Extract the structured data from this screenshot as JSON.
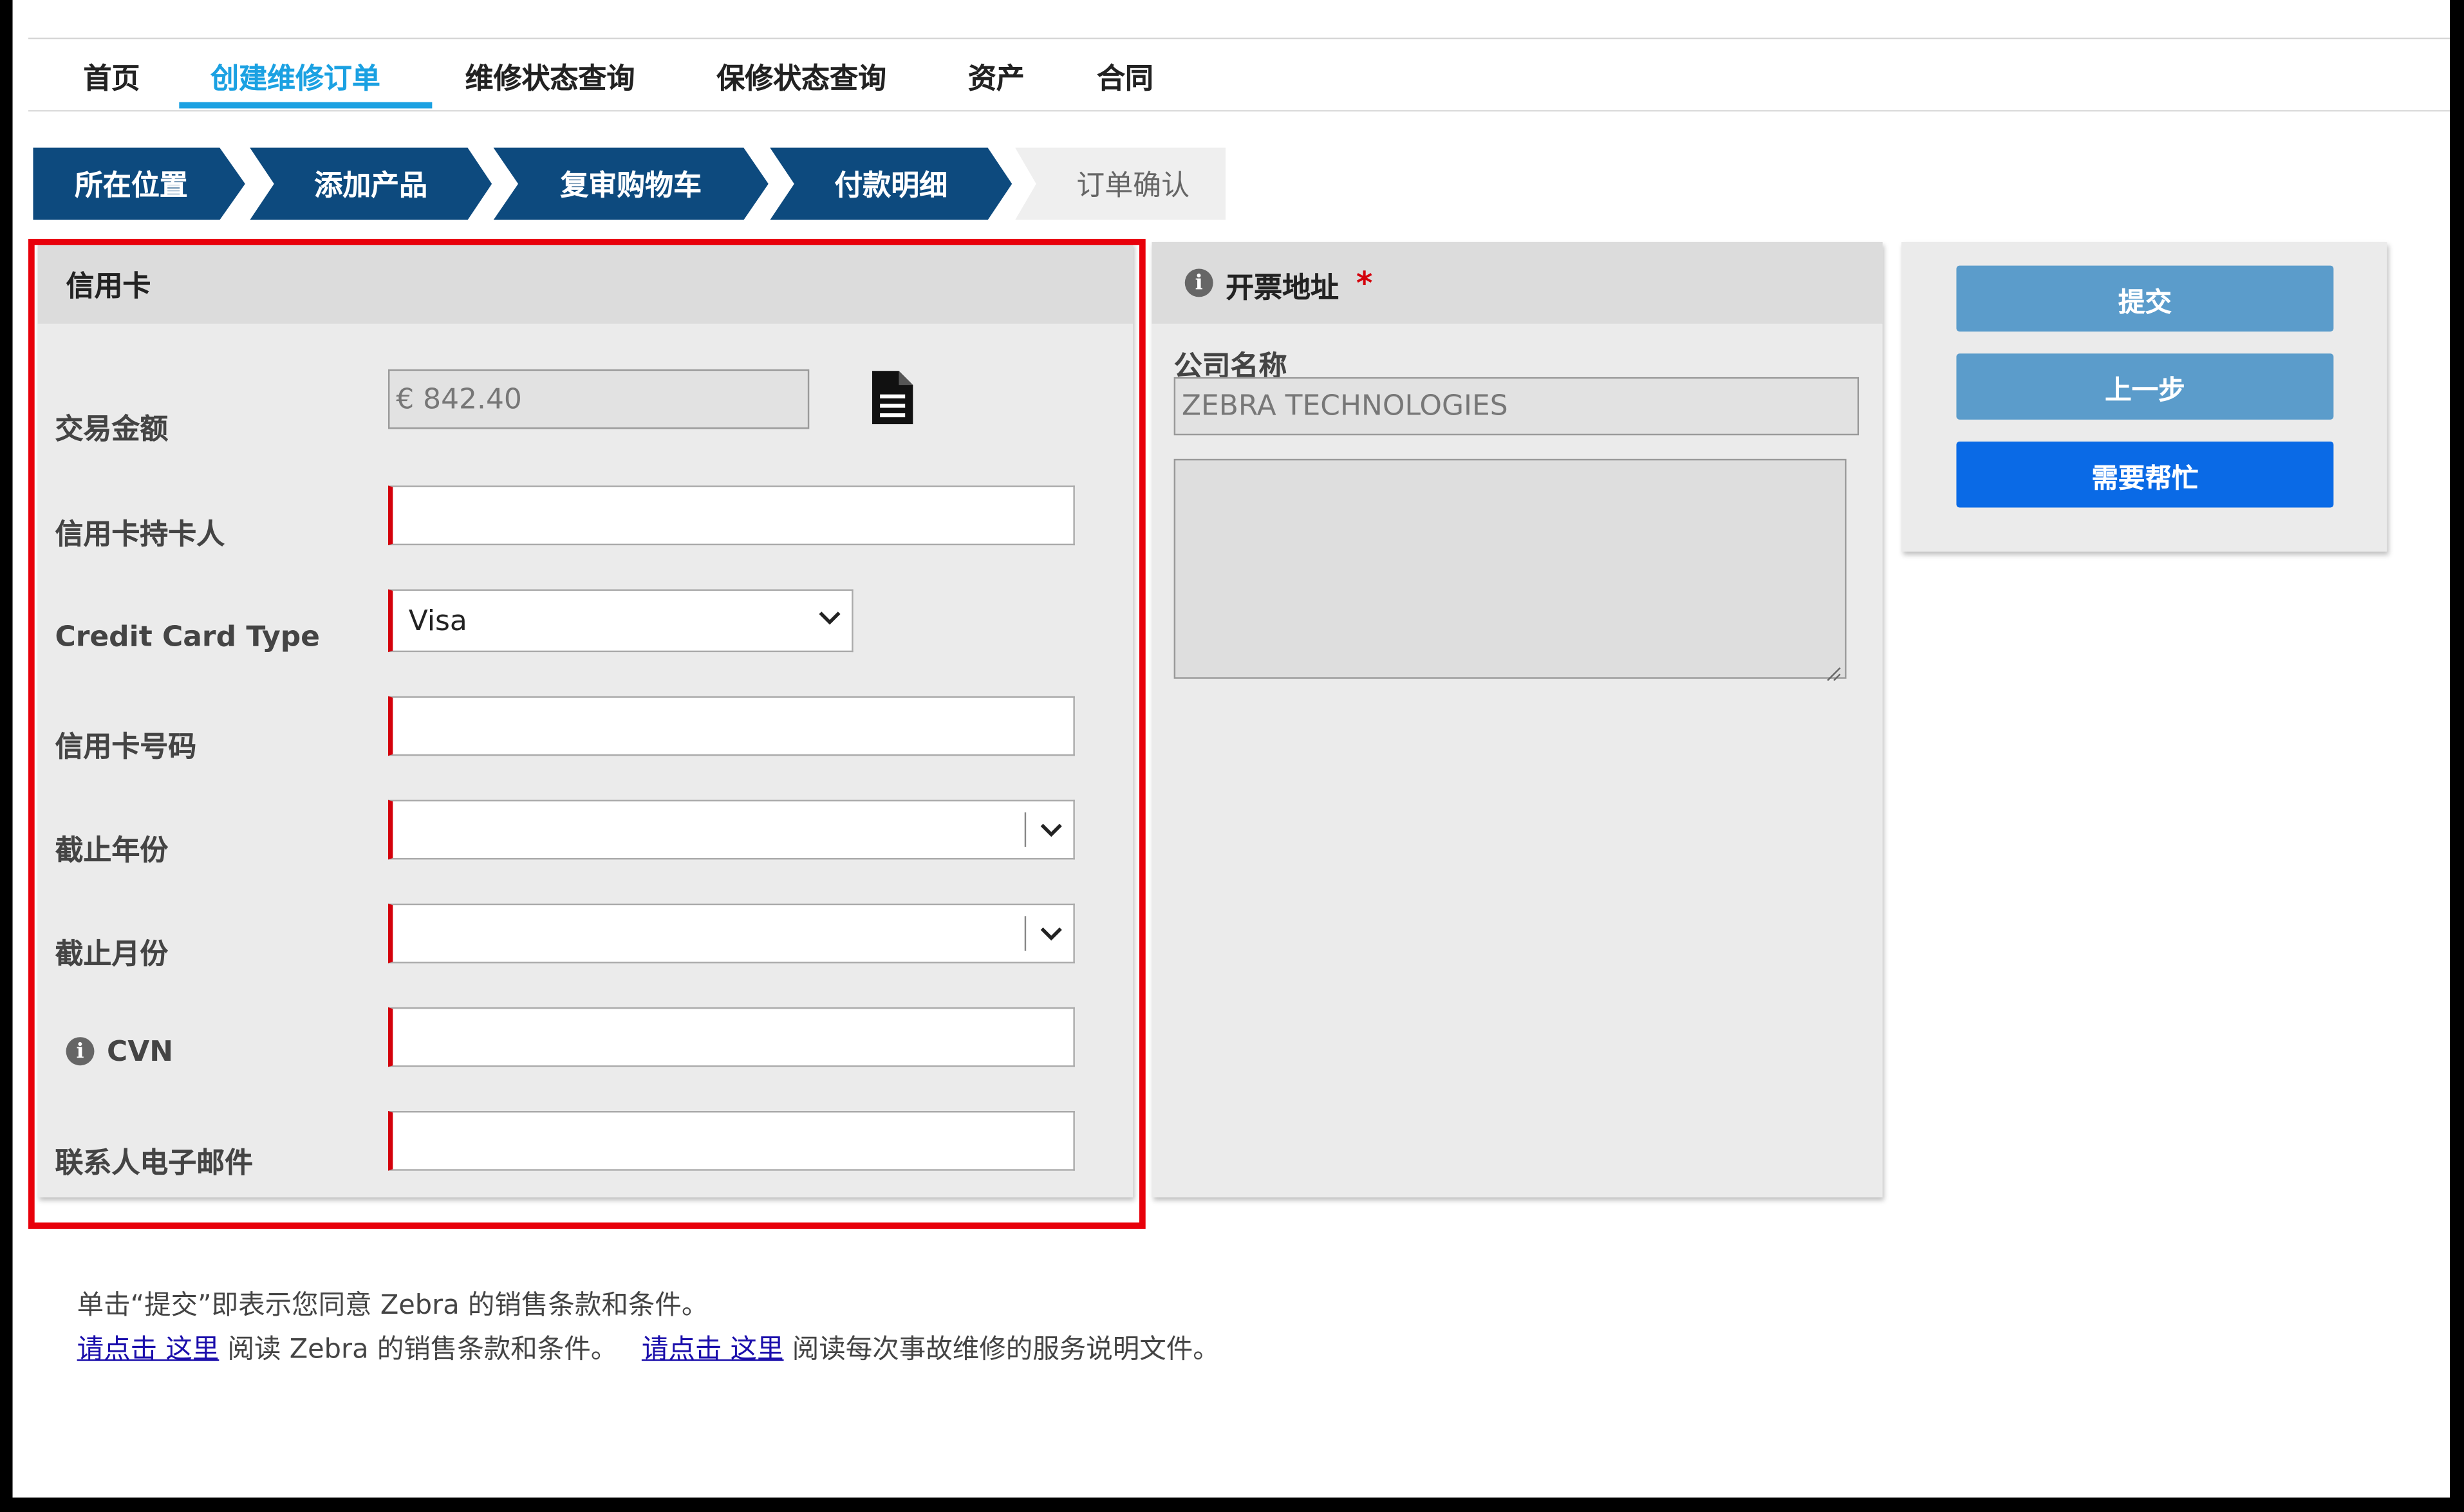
{
  "nav": {
    "items": [
      "首页",
      "创建维修订单",
      "维修状态查询",
      "保修状态查询",
      "资产",
      "合同"
    ],
    "active_index": 1
  },
  "steps": {
    "items": [
      "所在位置",
      "添加产品",
      "复审购物车",
      "付款明细",
      "订单确认"
    ],
    "current_index": 3
  },
  "credit_card": {
    "title": "信用卡",
    "amount_label": "交易金额",
    "amount_value": "€ 842.40",
    "cardholder_label": "信用卡持卡人",
    "card_type_label": "Credit Card Type",
    "card_type_value": "Visa",
    "card_number_label": "信用卡号码",
    "exp_year_label": "截止年份",
    "exp_month_label": "截止月份",
    "cvn_label": "CVN",
    "email_label": "联系人电子邮件"
  },
  "billing": {
    "title": "开票地址",
    "required_mark": "*",
    "company_label": "公司名称",
    "company_value": "ZEBRA TECHNOLOGIES"
  },
  "actions": {
    "submit": "提交",
    "back": "上一步",
    "help": "需要帮忙"
  },
  "footer": {
    "line1": "单击“提交”即表示您同意 Zebra 的销售条款和条件。",
    "link1": "请点击 这里",
    "text1": " 阅读 Zebra 的销售条款和条件。",
    "link2": "请点击 这里",
    "text2": " 阅读每次事故维修的服务说明文件。"
  },
  "colors": {
    "accent": "#1ba1e2",
    "step_done": "#0d4a7e",
    "highlight": "#e8000b",
    "required": "#d4000b",
    "button_gray_blue": "#5b9ccb",
    "button_blue": "#0a6ae6"
  }
}
